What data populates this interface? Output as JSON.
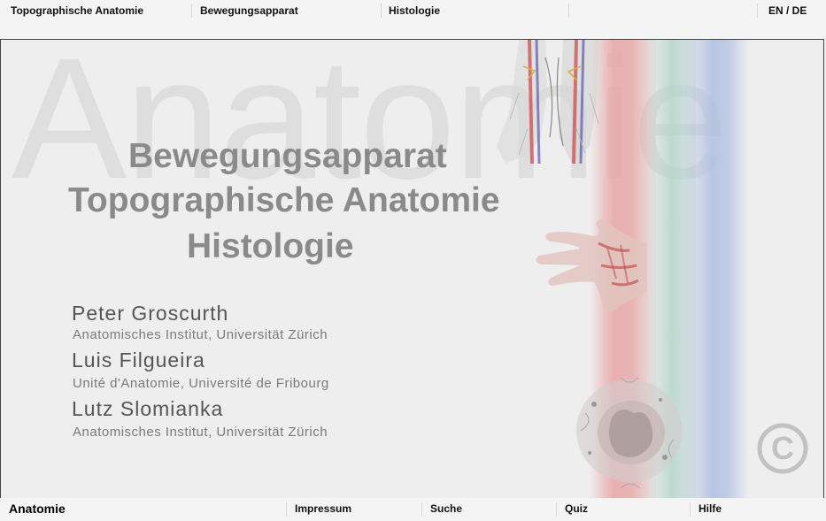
{
  "top_nav": {
    "items": [
      "Topographische Anatomie",
      "Bewegungsapparat",
      "Histologie",
      ""
    ],
    "language": "EN / DE"
  },
  "hero": {
    "watermark": "Anatomie",
    "subjects": [
      "Bewegungsapparat",
      "Topographische Anatomie",
      "Histologie"
    ]
  },
  "authors": [
    {
      "name": "Peter Groscurth",
      "institution": "Anatomisches Institut, Universität Zürich"
    },
    {
      "name": "Luis Filgueira",
      "institution": "Unité d'Anatomie, Université de Fribourg"
    },
    {
      "name": "Lutz Slomianka",
      "institution": "Anatomisches Institut, Universität Zürich"
    }
  ],
  "copyright_symbol": "©",
  "bottom_nav": {
    "brand": "Anatomie",
    "links": [
      "Impressum",
      "Suche",
      "Quiz",
      "Hilfe"
    ]
  },
  "colors": {
    "red_strip": "#e8a5a5",
    "green_strip": "#afd4c8",
    "blue_strip": "#afbee1",
    "subject_text": "#8a8a8a"
  }
}
